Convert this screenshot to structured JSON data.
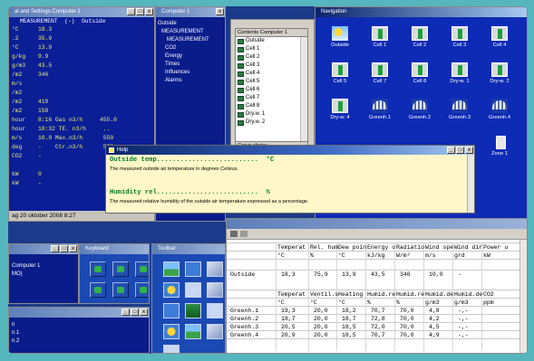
{
  "windows": {
    "measurement": {
      "title": "al and Settings Computer 1",
      "header": "MEASUREMENT  (-)  Outside",
      "rows": [
        {
          "unit": "°C",
          "value": "18.3"
        },
        {
          "unit": ".2",
          "value": "35.9"
        },
        {
          "unit": "°C",
          "value": "13.9"
        },
        {
          "unit": "g/kg",
          "value": "9.9"
        },
        {
          "unit": "g/m3",
          "value": "43.5"
        },
        {
          "unit": "/m2",
          "value": "346"
        },
        {
          "unit": "m/s",
          "value": ""
        },
        {
          "unit": "/m2",
          "value": ""
        },
        {
          "unit": "/m2",
          "value": "419"
        },
        {
          "unit": "/m2",
          "value": "158"
        },
        {
          "unit": "hour",
          "value": "8:16 Gas n3/h     455.0"
        },
        {
          "unit": "hour",
          "value": "18:32 TE. n3/h     .."
        },
        {
          "unit": "m/s",
          "value": "10.0 Max.n3/h      550"
        },
        {
          "unit": "deg",
          "value": "-    Ctr.n3/h      550"
        },
        {
          "unit": "CO2",
          "value": "-"
        },
        {
          "unit": "",
          "value": ""
        },
        {
          "unit": "kW",
          "value": "0"
        },
        {
          "unit": "kW",
          "value": "-"
        }
      ],
      "status": "ag 20 oktober 2008  8:27"
    },
    "computer": {
      "title": "Computer 1",
      "items": [
        "Outside",
        "MEASUREMENT",
        "MEASUREMENT",
        "CO2",
        "Energy",
        "Times",
        "Influences",
        "Alarms"
      ]
    },
    "contents": {
      "header": "Contents Computer 1",
      "items": [
        "Outside",
        "Cell 1",
        "Cell 2",
        "Cell 3",
        "Cell 4",
        "Cell 5",
        "Cell 6",
        "Cell 7",
        "Cell 8",
        "Dry.w. 1",
        "Dry.w. 2"
      ],
      "button": "Group choice"
    },
    "navigation": {
      "title": "Navigation",
      "icons": [
        {
          "label": "Outside",
          "kind": "outside"
        },
        {
          "label": "Cell 1",
          "kind": "cell"
        },
        {
          "label": "Cell 2",
          "kind": "cell"
        },
        {
          "label": "Cell 3",
          "kind": "cell"
        },
        {
          "label": "Cell 4",
          "kind": "cell"
        },
        {
          "label": "Cell 5",
          "kind": "cell"
        },
        {
          "label": "Cell 7",
          "kind": "cell"
        },
        {
          "label": "Cell 8",
          "kind": "cell"
        },
        {
          "label": "Dry-w. 1",
          "kind": "cell"
        },
        {
          "label": "Dry-w. 2",
          "kind": "cell"
        },
        {
          "label": "Dry-w. 4",
          "kind": "cell"
        },
        {
          "label": "Greenh.1",
          "kind": "green"
        },
        {
          "label": "Greenh.2",
          "kind": "green"
        },
        {
          "label": "Greenh.3",
          "kind": "green"
        },
        {
          "label": "Greenh.4",
          "kind": "green"
        },
        {
          "label": "Zone 1",
          "kind": "zone"
        }
      ]
    },
    "help": {
      "title": "Help",
      "entries": [
        {
          "title": "Outside temp..........................  °C",
          "desc": "The measured outside air temperature in degrees Celsius."
        },
        {
          "title": "Humidity rel..........................  %",
          "desc": "The measured relative humidity of the outside air temperature expressed as a percentage."
        }
      ]
    },
    "computer_small": {
      "title": "",
      "items": [
        "Computer 1",
        "MO)"
      ]
    },
    "keyboard": {
      "title": "Keyboard"
    },
    "toolbar": {
      "title": "Toolbar"
    },
    "list": {
      "title": "",
      "items": [
        "n",
        "n.1",
        "n.2"
      ]
    },
    "data": {
      "title": "",
      "columns": [
        "Temperat",
        "Rel. hum",
        "Dew poin",
        "Energy o",
        "Radiatio",
        "Wind spe",
        "Wind dir",
        "Power u"
      ],
      "units": [
        "°C",
        "%",
        "°C",
        "kJ/kg",
        "W/m²",
        "m/s",
        "grd",
        "kW"
      ],
      "outside_row": {
        "label": "Outside",
        "values": [
          "18,3",
          "75,9",
          "13,9",
          "43,5",
          "346",
          "10,0",
          "-",
          ""
        ]
      },
      "columns2": [
        "Temperat",
        "Ventil.s",
        "Heating",
        "Humid.re",
        "Humid.re",
        "Humid.de",
        "Humid.de",
        "CO2"
      ],
      "units2": [
        "°C",
        "°C",
        "°C",
        "%",
        "%",
        "g/m3",
        "g/m3",
        "ppm"
      ],
      "rows2": [
        {
          "label": "Greenh.1",
          "values": [
            "19,3",
            "20,0",
            "18,2",
            "70,7",
            "70,0",
            "4,8",
            "-,-",
            ""
          ]
        },
        {
          "label": "Greenh.2",
          "values": [
            "18,7",
            "20,0",
            "18,7",
            "72,8",
            "70,0",
            "4,2",
            "-,-",
            ""
          ]
        },
        {
          "label": "Greenh.3",
          "values": [
            "20,5",
            "20,0",
            "18,5",
            "72,0",
            "70,0",
            "4,5",
            "-,-",
            ""
          ]
        },
        {
          "label": "Greenh.4",
          "values": [
            "20,9",
            "20,0",
            "18,5",
            "70,7",
            "70,0",
            "4,9",
            "-,-",
            ""
          ]
        }
      ]
    }
  },
  "colors": {
    "background": "#55b6bd",
    "desktop": "#1c3a8a",
    "help_bg": "#fff7c9",
    "help_title": "#0a7a25",
    "measurement_text": "#e8ee6a"
  }
}
